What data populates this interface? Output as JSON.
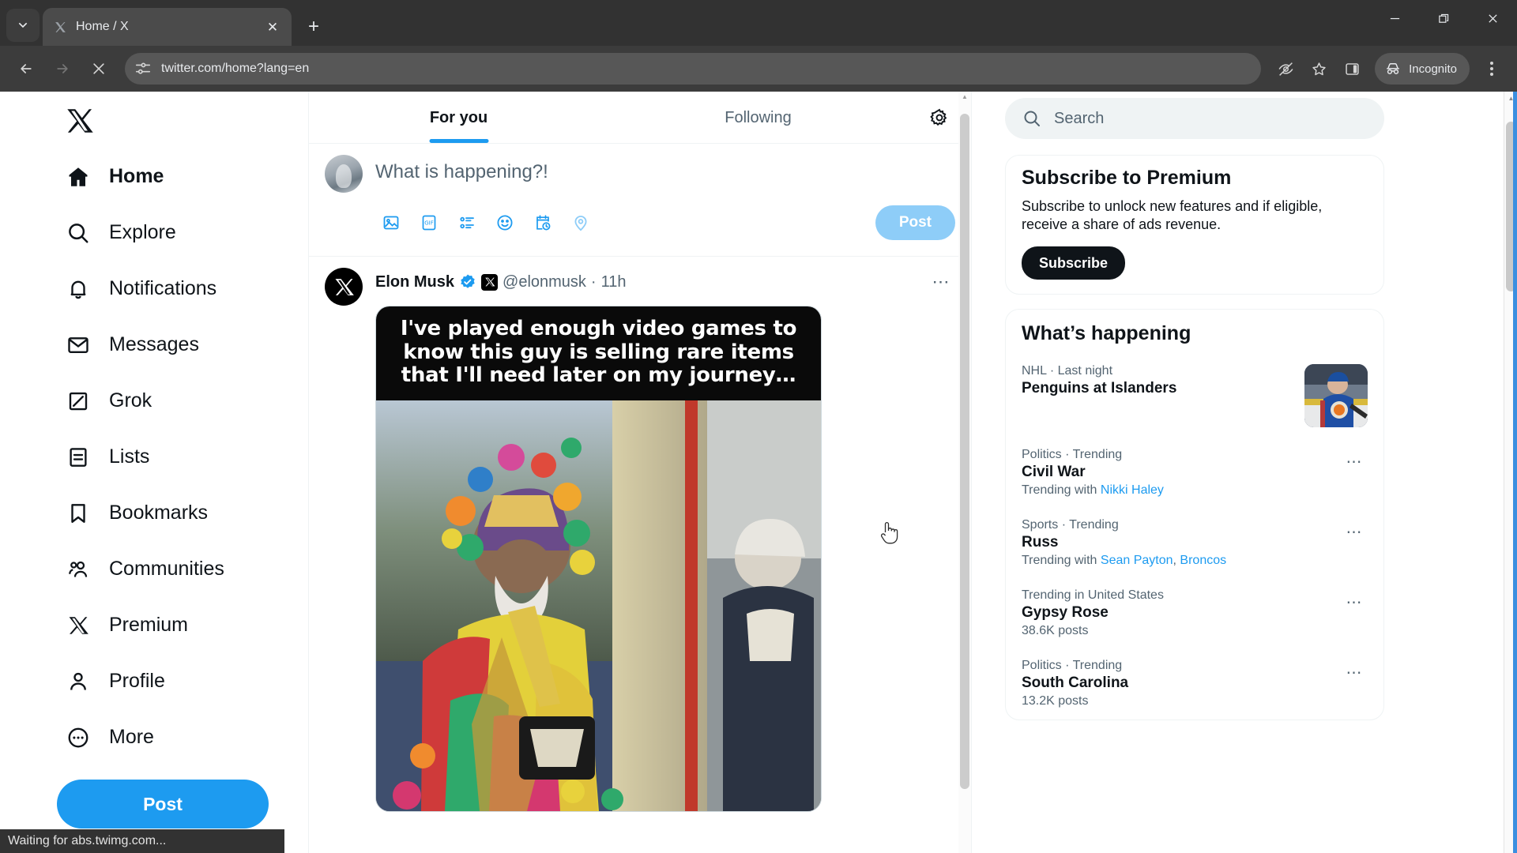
{
  "browser": {
    "tab": {
      "title": "Home / X",
      "favicon_icon": "x-favicon"
    },
    "new_tab_label": "+",
    "url": "twitter.com/home?lang=en",
    "profile_label": "Incognito",
    "status_text": "Waiting for abs.twimg.com...",
    "window_controls": {
      "minimize": "minimize-icon",
      "maximize": "maximize-icon",
      "close": "close-icon"
    },
    "toolbar_icons": [
      "back-icon",
      "forward-icon",
      "stop-loading-icon",
      "site-settings-icon",
      "tracking-protection-icon",
      "bookmark-star-icon",
      "side-panel-icon",
      "incognito-icon",
      "chrome-menu-icon"
    ]
  },
  "sidebar": {
    "logo_icon": "x-logo-icon",
    "items": [
      {
        "label": "Home",
        "icon": "home-icon",
        "active": true
      },
      {
        "label": "Explore",
        "icon": "search-icon",
        "active": false
      },
      {
        "label": "Notifications",
        "icon": "bell-icon",
        "active": false
      },
      {
        "label": "Messages",
        "icon": "mail-icon",
        "active": false
      },
      {
        "label": "Grok",
        "icon": "grok-icon",
        "active": false
      },
      {
        "label": "Lists",
        "icon": "lists-icon",
        "active": false
      },
      {
        "label": "Bookmarks",
        "icon": "bookmark-icon",
        "active": false
      },
      {
        "label": "Communities",
        "icon": "communities-icon",
        "active": false
      },
      {
        "label": "Premium",
        "icon": "x-icon",
        "active": false
      },
      {
        "label": "Profile",
        "icon": "person-icon",
        "active": false
      },
      {
        "label": "More",
        "icon": "more-circle-icon",
        "active": false
      }
    ],
    "post_button": "Post"
  },
  "feed": {
    "tabs": [
      {
        "label": "For you",
        "active": true
      },
      {
        "label": "Following",
        "active": false
      }
    ],
    "settings_icon": "gear-icon",
    "compose": {
      "placeholder": "What is happening?!",
      "post_label": "Post",
      "tools": [
        "image-icon",
        "gif-icon",
        "poll-icon",
        "emoji-icon",
        "schedule-icon",
        "location-icon"
      ]
    },
    "tweet": {
      "author": "Elon Musk",
      "verified_icon": "verified-badge-icon",
      "affiliate_icon": "x-affiliate-badge",
      "handle": "@elonmusk",
      "separator": "·",
      "time": "11h",
      "more_icon": "more-horizontal-icon",
      "meme_caption": "I've played enough video games to know this guy is selling rare items that I'll need later on my journey…"
    }
  },
  "right": {
    "search": {
      "placeholder": "Search",
      "icon": "search-icon"
    },
    "premium_card": {
      "title": "Subscribe to Premium",
      "description": "Subscribe to unlock new features and if eligible, receive a share of ads revenue.",
      "button": "Subscribe"
    },
    "whats_happening": {
      "title": "What’s happening",
      "trends": [
        {
          "category": "NHL · Last night",
          "name": "Penguins at Islanders",
          "sub": "",
          "thumb": true,
          "dots": false
        },
        {
          "category": "Politics · Trending",
          "name": "Civil War",
          "sub_prefix": "Trending with ",
          "sub_links": [
            "Nikki Haley"
          ],
          "thumb": false,
          "dots": true
        },
        {
          "category": "Sports · Trending",
          "name": "Russ",
          "sub_prefix": "Trending with ",
          "sub_links": [
            "Sean Payton",
            "Broncos"
          ],
          "thumb": false,
          "dots": true
        },
        {
          "category": "Trending in United States",
          "name": "Gypsy Rose",
          "sub": "38.6K posts",
          "thumb": false,
          "dots": true
        },
        {
          "category": "Politics · Trending",
          "name": "South Carolina",
          "sub": "13.2K posts",
          "thumb": false,
          "dots": true
        }
      ]
    }
  },
  "colors": {
    "accent": "#1d9bf0",
    "text": "#0f1419",
    "muted": "#536471",
    "chrome": "#3c3c3c"
  }
}
